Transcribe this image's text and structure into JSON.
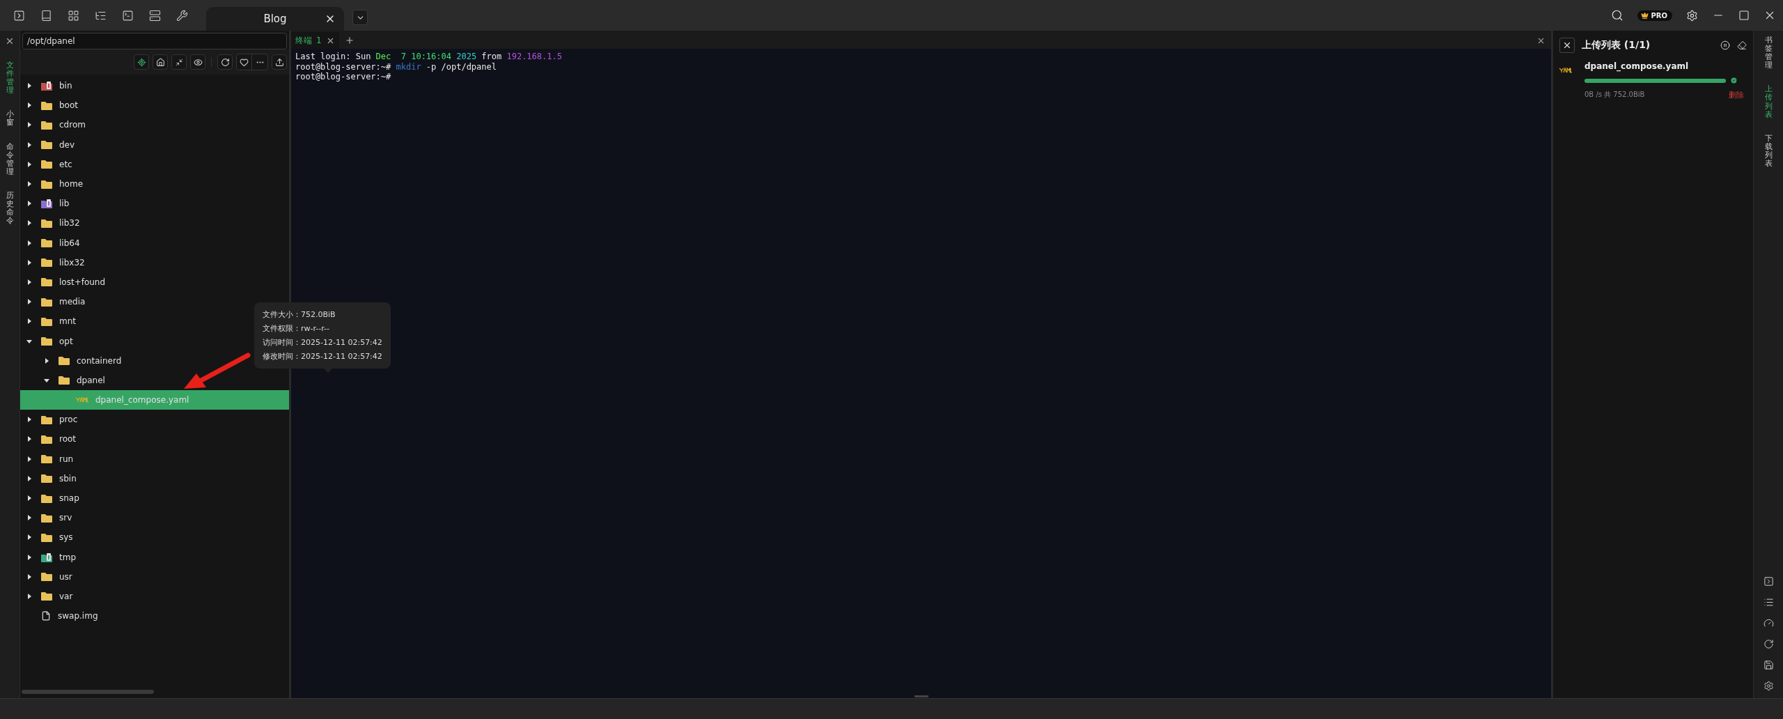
{
  "titlebar": {
    "tabs": [
      {
        "label": "Blog",
        "selected": true
      }
    ],
    "badge": "PRO"
  },
  "left_strip": {
    "items": [
      {
        "label": "文件管理",
        "selected": true
      },
      {
        "label": "小窗",
        "selected": false
      },
      {
        "label": "命令管理",
        "selected": false
      },
      {
        "label": "历史命令",
        "selected": false
      }
    ]
  },
  "file_panel": {
    "path": "/opt/dpanel",
    "tree": [
      {
        "name": "bin",
        "kind": "special",
        "color": "#c25050",
        "expanded": false,
        "selected": false
      },
      {
        "name": "boot",
        "kind": "folder",
        "expanded": false,
        "selected": false
      },
      {
        "name": "cdrom",
        "kind": "folder",
        "expanded": false,
        "selected": false
      },
      {
        "name": "dev",
        "kind": "folder",
        "expanded": false,
        "selected": false
      },
      {
        "name": "etc",
        "kind": "folder",
        "expanded": false,
        "selected": false
      },
      {
        "name": "home",
        "kind": "folder",
        "expanded": false,
        "selected": false
      },
      {
        "name": "lib",
        "kind": "special",
        "color": "#8a6fd0",
        "expanded": false,
        "selected": false
      },
      {
        "name": "lib32",
        "kind": "folder",
        "expanded": false,
        "selected": false
      },
      {
        "name": "lib64",
        "kind": "folder",
        "expanded": false,
        "selected": false
      },
      {
        "name": "libx32",
        "kind": "folder",
        "expanded": false,
        "selected": false
      },
      {
        "name": "lost+found",
        "kind": "folder",
        "expanded": false,
        "selected": false
      },
      {
        "name": "media",
        "kind": "folder",
        "expanded": false,
        "selected": false
      },
      {
        "name": "mnt",
        "kind": "folder",
        "expanded": false,
        "selected": false
      },
      {
        "name": "opt",
        "kind": "folder",
        "expanded": true,
        "selected": false,
        "children": [
          {
            "name": "containerd",
            "kind": "folder",
            "expanded": false,
            "selected": false
          },
          {
            "name": "dpanel",
            "kind": "folder",
            "expanded": true,
            "selected": false,
            "children": [
              {
                "name": "dpanel_compose.yaml",
                "kind": "yaml",
                "selected": true
              }
            ]
          }
        ]
      },
      {
        "name": "proc",
        "kind": "folder",
        "expanded": false,
        "selected": false
      },
      {
        "name": "root",
        "kind": "folder",
        "expanded": false,
        "selected": false
      },
      {
        "name": "run",
        "kind": "folder",
        "expanded": false,
        "selected": false
      },
      {
        "name": "sbin",
        "kind": "folder",
        "expanded": false,
        "selected": false
      },
      {
        "name": "snap",
        "kind": "folder",
        "expanded": false,
        "selected": false
      },
      {
        "name": "srv",
        "kind": "folder",
        "expanded": false,
        "selected": false
      },
      {
        "name": "sys",
        "kind": "folder",
        "expanded": false,
        "selected": false
      },
      {
        "name": "tmp",
        "kind": "special",
        "color": "#3aa88a",
        "expanded": false,
        "selected": false
      },
      {
        "name": "usr",
        "kind": "folder",
        "expanded": false,
        "selected": false
      },
      {
        "name": "var",
        "kind": "folder",
        "expanded": false,
        "selected": false
      },
      {
        "name": "swap.img",
        "kind": "file",
        "selected": false
      }
    ]
  },
  "tooltip": {
    "lines": [
      "文件大小：752.0BiB",
      "文件权限：rw-r--r--",
      "访问时间：2025-12-11 02:57:42",
      "修改时间：2025-12-11 02:57:42"
    ]
  },
  "terminal": {
    "tabs": [
      {
        "label": "终端",
        "number": "1",
        "selected": true
      }
    ],
    "lines": [
      [
        {
          "text": "Last login: Sun ",
          "color": "#e8e8e8"
        },
        {
          "text": "Dec",
          "color": "#5cf04a"
        },
        {
          "text": "  7 10:16:04",
          "color": "#40e070"
        },
        {
          "text": " 2025",
          "color": "#3ad0c8"
        },
        {
          "text": " from ",
          "color": "#e8e8e8"
        },
        {
          "text": "192.168.1.5",
          "color": "#b455e0"
        }
      ],
      [
        {
          "text": "root@blog-server:~# ",
          "color": "#e8e8e8"
        },
        {
          "text": "mkdir",
          "color": "#3a78c8"
        },
        {
          "text": " -p /opt/dpanel",
          "color": "#e8e8e8"
        }
      ],
      [
        {
          "text": "root@blog-server:~#",
          "color": "#e8e8e8"
        }
      ]
    ]
  },
  "upload_panel": {
    "title": "上传列表 (1/1)",
    "items": [
      {
        "name": "dpanel_compose.yaml",
        "level": 1,
        "done": true,
        "info": "0B /s  共 752.0BiB",
        "action": "删除"
      }
    ]
  },
  "right_strip": {
    "items": [
      {
        "label": "书签管理",
        "selected": false
      },
      {
        "label": "上传列表",
        "selected": true
      },
      {
        "label": "下载列表",
        "selected": false
      }
    ]
  }
}
